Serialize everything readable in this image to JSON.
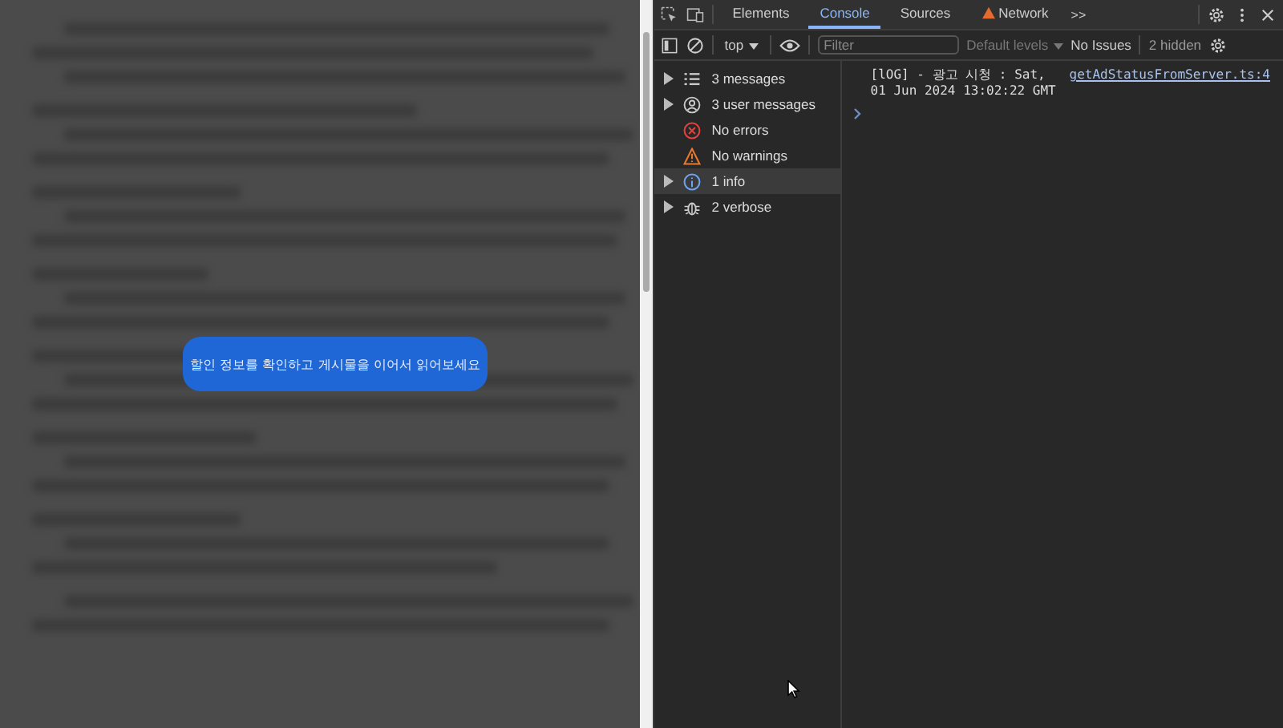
{
  "page": {
    "popup": {
      "label": "할인 정보를 확인하고 게시물을 이어서 읽어보세요"
    }
  },
  "devtools": {
    "tabs": [
      {
        "label": "Elements",
        "selected": false,
        "warning": false
      },
      {
        "label": "Console",
        "selected": true,
        "warning": false
      },
      {
        "label": "Sources",
        "selected": false,
        "warning": false
      },
      {
        "label": "Network",
        "selected": false,
        "warning": true
      }
    ],
    "more_tabs": ">>",
    "toolbar": {
      "context": "top",
      "filter": {
        "placeholder": "Filter"
      },
      "levels": "Default levels",
      "issues": "No Issues",
      "hidden": "2 hidden"
    },
    "sidebar": {
      "items": [
        {
          "kind": "list",
          "label": "3 messages",
          "expandable": true,
          "selected": false
        },
        {
          "kind": "user",
          "label": "3 user messages",
          "expandable": true,
          "selected": false
        },
        {
          "kind": "error",
          "label": "No errors",
          "expandable": false,
          "selected": false
        },
        {
          "kind": "warning",
          "label": "No warnings",
          "expandable": false,
          "selected": false
        },
        {
          "kind": "info",
          "label": "1 info",
          "expandable": true,
          "selected": true
        },
        {
          "kind": "verbose",
          "label": "2 verbose",
          "expandable": true,
          "selected": false
        }
      ]
    },
    "console": {
      "messages": [
        {
          "text": "[lOG] - 광고 시청 :  Sat, 01 Jun 2024 13:02:22 GMT",
          "source": "getAdStatusFromServer.ts:4"
        }
      ]
    }
  }
}
